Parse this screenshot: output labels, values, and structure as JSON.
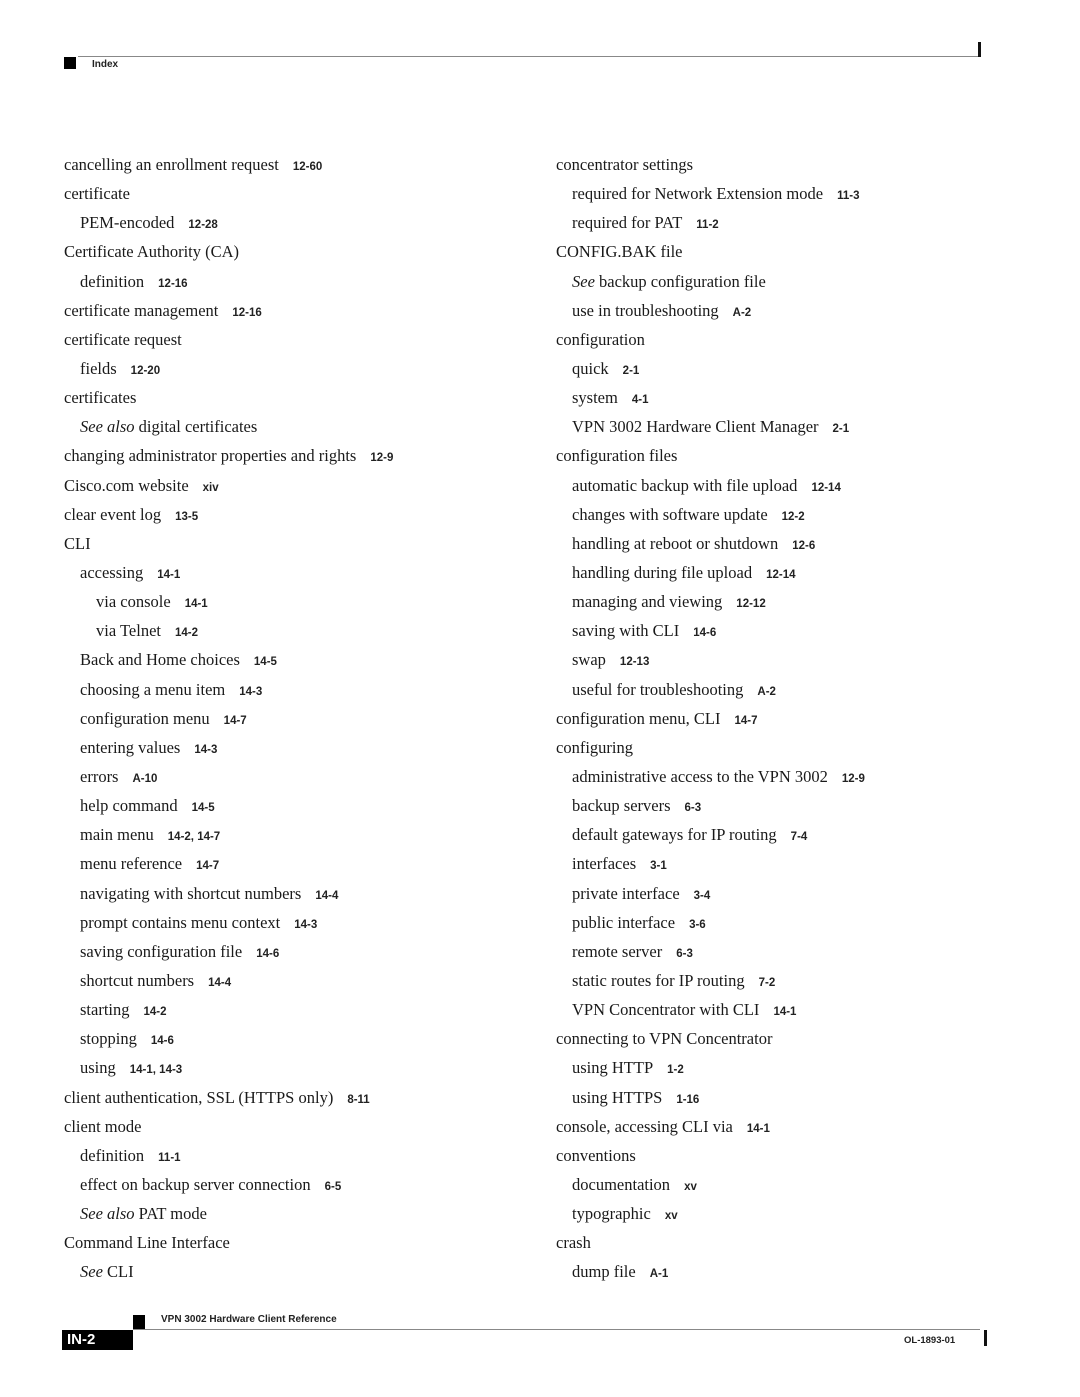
{
  "header": {
    "section_label": "Index"
  },
  "left_column": [
    {
      "level": 1,
      "text": "cancelling an enrollment request",
      "pages": "12-60"
    },
    {
      "level": 1,
      "text": "certificate",
      "pages": ""
    },
    {
      "level": 2,
      "text": "PEM-encoded",
      "pages": "12-28"
    },
    {
      "level": 1,
      "text": "Certificate Authority (CA)",
      "pages": ""
    },
    {
      "level": 2,
      "text": "definition",
      "pages": "12-16"
    },
    {
      "level": 1,
      "text": "certificate management",
      "pages": "12-16"
    },
    {
      "level": 1,
      "text": "certificate request",
      "pages": ""
    },
    {
      "level": 2,
      "text": "fields",
      "pages": "12-20"
    },
    {
      "level": 1,
      "text": "certificates",
      "pages": ""
    },
    {
      "level": 2,
      "italic_prefix": "See also",
      "text": " digital certificates",
      "pages": ""
    },
    {
      "level": 1,
      "text": "changing administrator properties and rights",
      "pages": "12-9"
    },
    {
      "level": 1,
      "text": "Cisco.com website",
      "pages": "xiv"
    },
    {
      "level": 1,
      "text": "clear event log",
      "pages": "13-5"
    },
    {
      "level": 1,
      "text": "CLI",
      "pages": ""
    },
    {
      "level": 2,
      "text": "accessing",
      "pages": "14-1"
    },
    {
      "level": 3,
      "text": "via console",
      "pages": "14-1"
    },
    {
      "level": 3,
      "text": "via Telnet",
      "pages": "14-2"
    },
    {
      "level": 2,
      "text": "Back and Home choices",
      "pages": "14-5"
    },
    {
      "level": 2,
      "text": "choosing a menu item",
      "pages": "14-3"
    },
    {
      "level": 2,
      "text": "configuration menu",
      "pages": "14-7"
    },
    {
      "level": 2,
      "text": "entering values",
      "pages": "14-3"
    },
    {
      "level": 2,
      "text": "errors",
      "pages": "A-10"
    },
    {
      "level": 2,
      "text": "help command",
      "pages": "14-5"
    },
    {
      "level": 2,
      "text": "main menu",
      "pages": "14-2, 14-7"
    },
    {
      "level": 2,
      "text": "menu reference",
      "pages": "14-7"
    },
    {
      "level": 2,
      "text": "navigating with shortcut numbers",
      "pages": "14-4"
    },
    {
      "level": 2,
      "text": "prompt contains menu context",
      "pages": "14-3"
    },
    {
      "level": 2,
      "text": "saving configuration file",
      "pages": "14-6"
    },
    {
      "level": 2,
      "text": "shortcut numbers",
      "pages": "14-4"
    },
    {
      "level": 2,
      "text": "starting",
      "pages": "14-2"
    },
    {
      "level": 2,
      "text": "stopping",
      "pages": "14-6"
    },
    {
      "level": 2,
      "text": "using",
      "pages": "14-1, 14-3"
    },
    {
      "level": 1,
      "text": "client authentication, SSL (HTTPS only)",
      "pages": "8-11"
    },
    {
      "level": 1,
      "text": "client mode",
      "pages": ""
    },
    {
      "level": 2,
      "text": "definition",
      "pages": "11-1"
    },
    {
      "level": 2,
      "text": "effect on backup server connection",
      "pages": "6-5"
    },
    {
      "level": 2,
      "italic_prefix": "See also",
      "text": " PAT mode",
      "pages": ""
    },
    {
      "level": 1,
      "text": "Command Line Interface",
      "pages": ""
    },
    {
      "level": 2,
      "italic_prefix": "See",
      "text": " CLI",
      "pages": ""
    }
  ],
  "right_column": [
    {
      "level": 1,
      "text": "concentrator settings",
      "pages": ""
    },
    {
      "level": 2,
      "text": "required for Network Extension mode",
      "pages": "11-3"
    },
    {
      "level": 2,
      "text": "required for PAT",
      "pages": "11-2"
    },
    {
      "level": 1,
      "text": "CONFIG.BAK file",
      "pages": ""
    },
    {
      "level": 2,
      "italic_prefix": "See",
      "text": " backup configuration file",
      "pages": ""
    },
    {
      "level": 2,
      "text": "use in troubleshooting",
      "pages": "A-2"
    },
    {
      "level": 1,
      "text": "configuration",
      "pages": ""
    },
    {
      "level": 2,
      "text": "quick",
      "pages": "2-1"
    },
    {
      "level": 2,
      "text": "system",
      "pages": "4-1"
    },
    {
      "level": 2,
      "text": "VPN 3002 Hardware Client Manager",
      "pages": "2-1"
    },
    {
      "level": 1,
      "text": "configuration files",
      "pages": ""
    },
    {
      "level": 2,
      "text": "automatic backup with file upload",
      "pages": "12-14"
    },
    {
      "level": 2,
      "text": "changes with software update",
      "pages": "12-2"
    },
    {
      "level": 2,
      "text": "handling at reboot or shutdown",
      "pages": "12-6"
    },
    {
      "level": 2,
      "text": "handling during file upload",
      "pages": "12-14"
    },
    {
      "level": 2,
      "text": "managing and viewing",
      "pages": "12-12"
    },
    {
      "level": 2,
      "text": "saving with CLI",
      "pages": "14-6"
    },
    {
      "level": 2,
      "text": "swap",
      "pages": "12-13"
    },
    {
      "level": 2,
      "text": "useful for troubleshooting",
      "pages": "A-2"
    },
    {
      "level": 1,
      "text": "configuration menu, CLI",
      "pages": "14-7"
    },
    {
      "level": 1,
      "text": "configuring",
      "pages": ""
    },
    {
      "level": 2,
      "text": "administrative access to the VPN 3002",
      "pages": "12-9"
    },
    {
      "level": 2,
      "text": "backup servers",
      "pages": "6-3"
    },
    {
      "level": 2,
      "text": "default gateways for IP routing",
      "pages": "7-4"
    },
    {
      "level": 2,
      "text": "interfaces",
      "pages": "3-1"
    },
    {
      "level": 2,
      "text": "private interface",
      "pages": "3-4"
    },
    {
      "level": 2,
      "text": "public interface",
      "pages": "3-6"
    },
    {
      "level": 2,
      "text": "remote server",
      "pages": "6-3"
    },
    {
      "level": 2,
      "text": "static routes for IP routing",
      "pages": "7-2"
    },
    {
      "level": 2,
      "text": "VPN Concentrator with CLI",
      "pages": "14-1"
    },
    {
      "level": 1,
      "text": "connecting to VPN Concentrator",
      "pages": ""
    },
    {
      "level": 2,
      "text": "using HTTP",
      "pages": "1-2"
    },
    {
      "level": 2,
      "text": "using HTTPS",
      "pages": "1-16"
    },
    {
      "level": 1,
      "text": "console, accessing CLI via",
      "pages": "14-1"
    },
    {
      "level": 1,
      "text": "conventions",
      "pages": ""
    },
    {
      "level": 2,
      "text": "documentation",
      "pages": "xv"
    },
    {
      "level": 2,
      "text": "typographic",
      "pages": "xv"
    },
    {
      "level": 1,
      "text": "crash",
      "pages": ""
    },
    {
      "level": 2,
      "text": "dump file",
      "pages": "A-1"
    }
  ],
  "footer": {
    "book_title": "VPN 3002 Hardware Client Reference",
    "page_number": "IN-2",
    "doc_number": "OL-1893-01"
  }
}
